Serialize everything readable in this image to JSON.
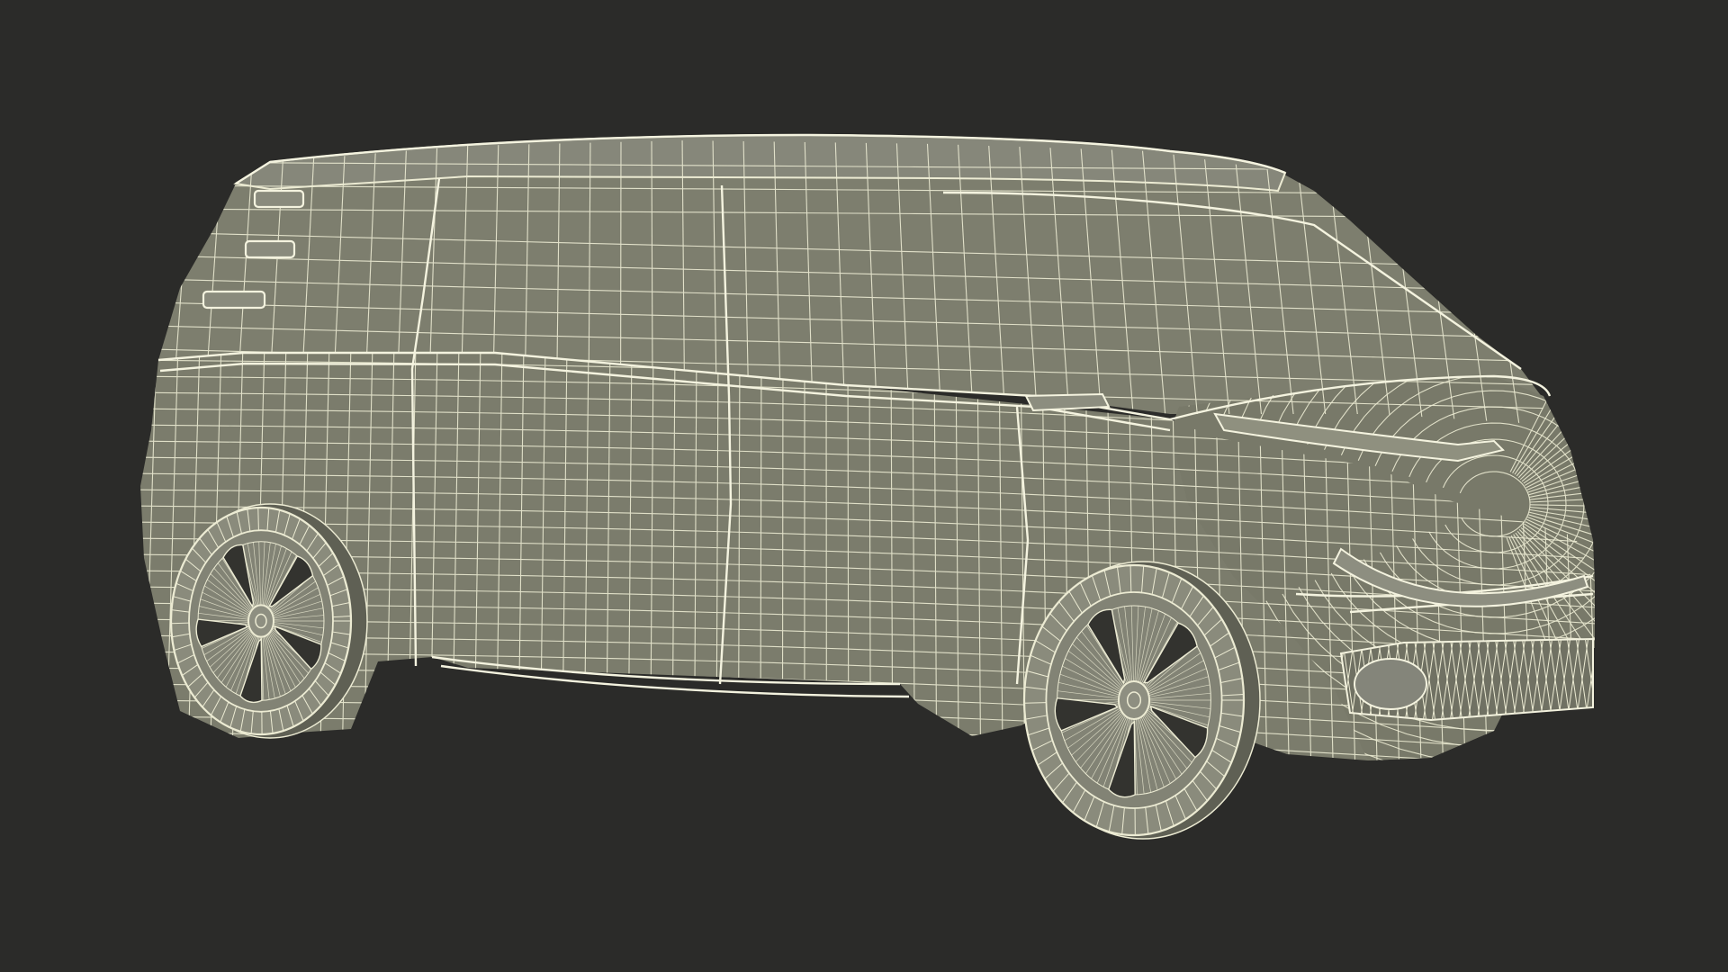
{
  "scene": {
    "subject": "wireframe-van-render",
    "background_color": "#2b2b29",
    "surface_color": "#7b7c6c",
    "wire_color": "#ecebd3",
    "shadow_color": "#5f6054"
  }
}
